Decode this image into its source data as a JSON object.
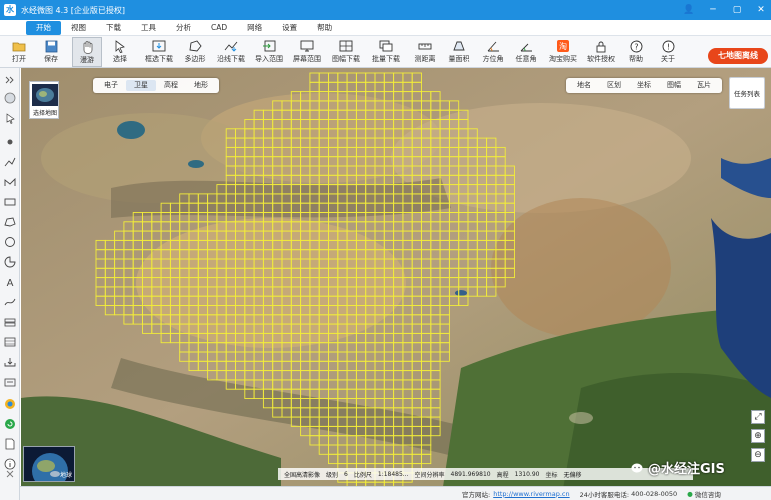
{
  "app": {
    "title": "水经微图 4.3 [企业版已授权]",
    "logo": "app-logo"
  },
  "menu": [
    "开始",
    "视图",
    "下载",
    "工具",
    "分析",
    "CAD",
    "网络",
    "设置",
    "帮助"
  ],
  "toolbar": [
    {
      "label": "打开",
      "icon": "folder-open-icon"
    },
    {
      "label": "保存",
      "icon": "save-icon"
    },
    {
      "label": "漫游",
      "icon": "hand-pan-icon"
    },
    {
      "label": "选择",
      "icon": "select-arrow-icon"
    },
    {
      "label": "框选下载",
      "icon": "box-download-icon"
    },
    {
      "label": "多边形",
      "icon": "polygon-icon"
    },
    {
      "label": "沿线下载",
      "icon": "polyline-download-icon"
    },
    {
      "label": "导入范围",
      "icon": "import-range-icon"
    },
    {
      "label": "屏幕范围",
      "icon": "screen-range-icon"
    },
    {
      "label": "图幅下载",
      "icon": "sheet-download-icon"
    },
    {
      "label": "批量下载",
      "icon": "batch-download-icon"
    },
    {
      "label": "测距离",
      "icon": "measure-distance-icon"
    },
    {
      "label": "量面积",
      "icon": "measure-area-icon"
    },
    {
      "label": "方位角",
      "icon": "azimuth-icon"
    },
    {
      "label": "任意角",
      "icon": "any-angle-icon"
    },
    {
      "label": "淘宝购买",
      "icon": "taobao-icon"
    },
    {
      "label": "软件授权",
      "icon": "license-lock-icon"
    },
    {
      "label": "帮助",
      "icon": "help-icon"
    },
    {
      "label": "关于",
      "icon": "about-icon"
    }
  ],
  "promo_badge": "七地图离线",
  "map": {
    "type_tabs": [
      "电子",
      "卫星",
      "高程",
      "地形"
    ],
    "active_type": "卫星",
    "overlay_tabs": [
      "地名",
      "区划",
      "坐标",
      "图幅",
      "瓦片"
    ],
    "task_list": "任务列表",
    "map_select_label": "选择地图",
    "globe_label": "地球",
    "status_source": "全国高清影像",
    "status_level_label": "级别",
    "status_level": "6",
    "status_scale_label": "比例尺",
    "status_scale": "1:18485...",
    "status_res_label": "空间分辨率",
    "status_res": "4891.969810",
    "status_elev_label": "高程",
    "status_elev": "1310.90",
    "status_coord_label": "坐标",
    "status_coord": "无偏移",
    "watermark": "@水经注GIS"
  },
  "status_bar": {
    "site_label": "官方网站:",
    "site_url": "http://www.rivermap.cn",
    "hotline_label": "24小时客服电话:",
    "hotline": "400-028-0050",
    "wechat": "微信咨询"
  },
  "colors": {
    "accent": "#1f8fe0",
    "grid": "#f2ec3a",
    "promo": "#e8461a"
  }
}
